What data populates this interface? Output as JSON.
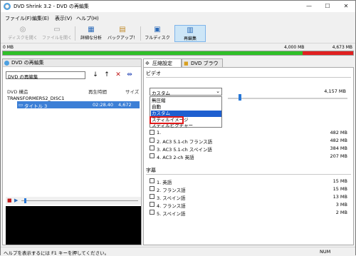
{
  "window": {
    "title": "DVD Shrink 3.2 - DVD の再編集",
    "controls": [
      "—",
      "☐",
      "✕"
    ]
  },
  "menu": [
    "ファイル(F)",
    "編集(E)",
    "表示(V)",
    "ヘルプ(H)"
  ],
  "toolbar": {
    "buttons": [
      {
        "label": "ディスクを開く",
        "icon": "open-disc-icon",
        "disabled": true
      },
      {
        "label": "ファイルを開く",
        "icon": "open-files-icon",
        "disabled": true
      },
      {
        "label": "詳細な分析",
        "icon": "analyze-icon",
        "disabled": false
      },
      {
        "label": "バックアップ！",
        "icon": "backup-icon",
        "disabled": false
      },
      {
        "label": "フルディスク",
        "icon": "full-disc-icon",
        "disabled": false
      },
      {
        "label": "再編集",
        "icon": "reauthor-icon",
        "disabled": false,
        "active": true
      }
    ]
  },
  "sizebar": {
    "left_label": "0 MB",
    "mid_label": "4,000 MB",
    "right_label": "4,673 MB",
    "green_fraction": 0.856,
    "colors": {
      "used": "#2fbf28",
      "over": "#e02020"
    }
  },
  "left_pane": {
    "header": "DVD の再編集",
    "name_value": "DVD の再編集",
    "tool_icons": [
      "↓",
      "↑",
      "✕",
      "⇹"
    ],
    "columns": {
      "structure": "DVD 構造",
      "time": "再生時間",
      "size": "サイズ"
    },
    "disc_name": "TRANSFORMERS2_DISC1",
    "title_row": {
      "name": "タイトル 3",
      "time": "02:28.40",
      "size": "4,672 MB"
    }
  },
  "player": {
    "stop": "■",
    "play": "▶"
  },
  "right_pane": {
    "tabs": [
      "圧縮設定",
      "DVD ブラウザ"
    ],
    "video_section": "ビデオ",
    "video_size": "4,157 MB",
    "dropdown_value": "カスタム",
    "dropdown_options": [
      "無圧縮",
      "自動",
      "カスタム",
      "スティルイメージ",
      "スティルピクチャー"
    ],
    "dropdown_selected_index": 2,
    "audio_tracks": [
      {
        "label": "1. ",
        "size": "482 MB"
      },
      {
        "label": "2. AC3 5.1-ch フランス語",
        "size": "482 MB"
      },
      {
        "label": "3. AC3 5.1-ch スペイン語",
        "size": "384 MB"
      },
      {
        "label": "4. AC3 2-ch 英語",
        "size": "207 MB"
      }
    ],
    "subtitle_section": "字幕",
    "subtitles": [
      {
        "label": "1. 英語",
        "size": "15 MB"
      },
      {
        "label": "2. フランス語",
        "size": "15 MB"
      },
      {
        "label": "3. スペイン語",
        "size": "13 MB"
      },
      {
        "label": "4. フランス語",
        "size": "3 MB"
      },
      {
        "label": "5. スペイン語",
        "size": "2 MB"
      }
    ]
  },
  "status": {
    "help": "ヘルプを表示するには F1 キーを押してください。",
    "num": "NUM"
  }
}
